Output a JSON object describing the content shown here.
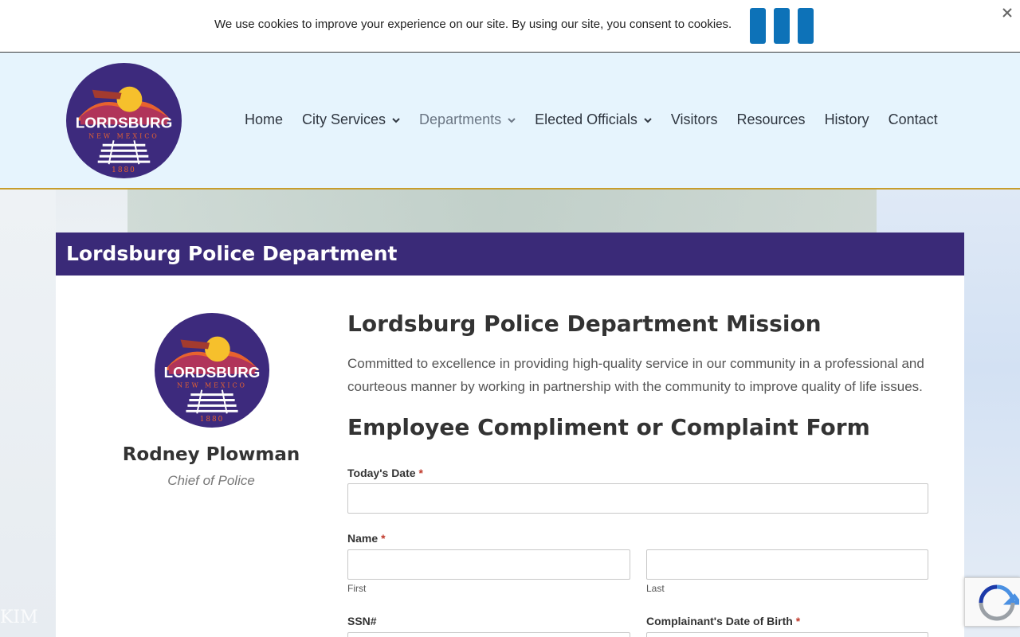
{
  "cookie_bar": {
    "message": "We use cookies to improve your experience on our site. By using our site, you consent to cookies."
  },
  "logo": {
    "name": "LORDSBURG",
    "state": "NEW MEXICO",
    "year": "1880"
  },
  "nav": {
    "items": [
      {
        "label": "Home",
        "has_dropdown": false,
        "active": false
      },
      {
        "label": "City Services",
        "has_dropdown": true,
        "active": false
      },
      {
        "label": "Departments",
        "has_dropdown": true,
        "active": true
      },
      {
        "label": "Elected Officials",
        "has_dropdown": true,
        "active": false
      },
      {
        "label": "Visitors",
        "has_dropdown": false,
        "active": false
      },
      {
        "label": "Resources",
        "has_dropdown": false,
        "active": false
      },
      {
        "label": "History",
        "has_dropdown": false,
        "active": false
      },
      {
        "label": "Contact",
        "has_dropdown": false,
        "active": false
      }
    ]
  },
  "page": {
    "title": "Lordsburg Police Department"
  },
  "profile": {
    "name": "Rodney Plowman",
    "role": "Chief of Police"
  },
  "mission": {
    "title": "Lordsburg Police Department Mission",
    "text": "Committed to excellence in providing high-quality service in our community in a professional and courteous manner by working in partnership with the community to improve quality of life issues."
  },
  "form": {
    "title": "Employee Compliment or Complaint Form",
    "todays_date_label": "Today's Date",
    "name_label": "Name",
    "first_sublabel": "First",
    "last_sublabel": "Last",
    "ssn_label": "SSN#",
    "dob_label": "Complainant's Date of Birth",
    "required_marker": "*"
  },
  "watermark": "KIM",
  "colors": {
    "title_bar": "#3a2a78",
    "accent_gold": "#c79d2c",
    "cookie_button": "#0d72b8",
    "header_bg": "#e6f4fd"
  }
}
